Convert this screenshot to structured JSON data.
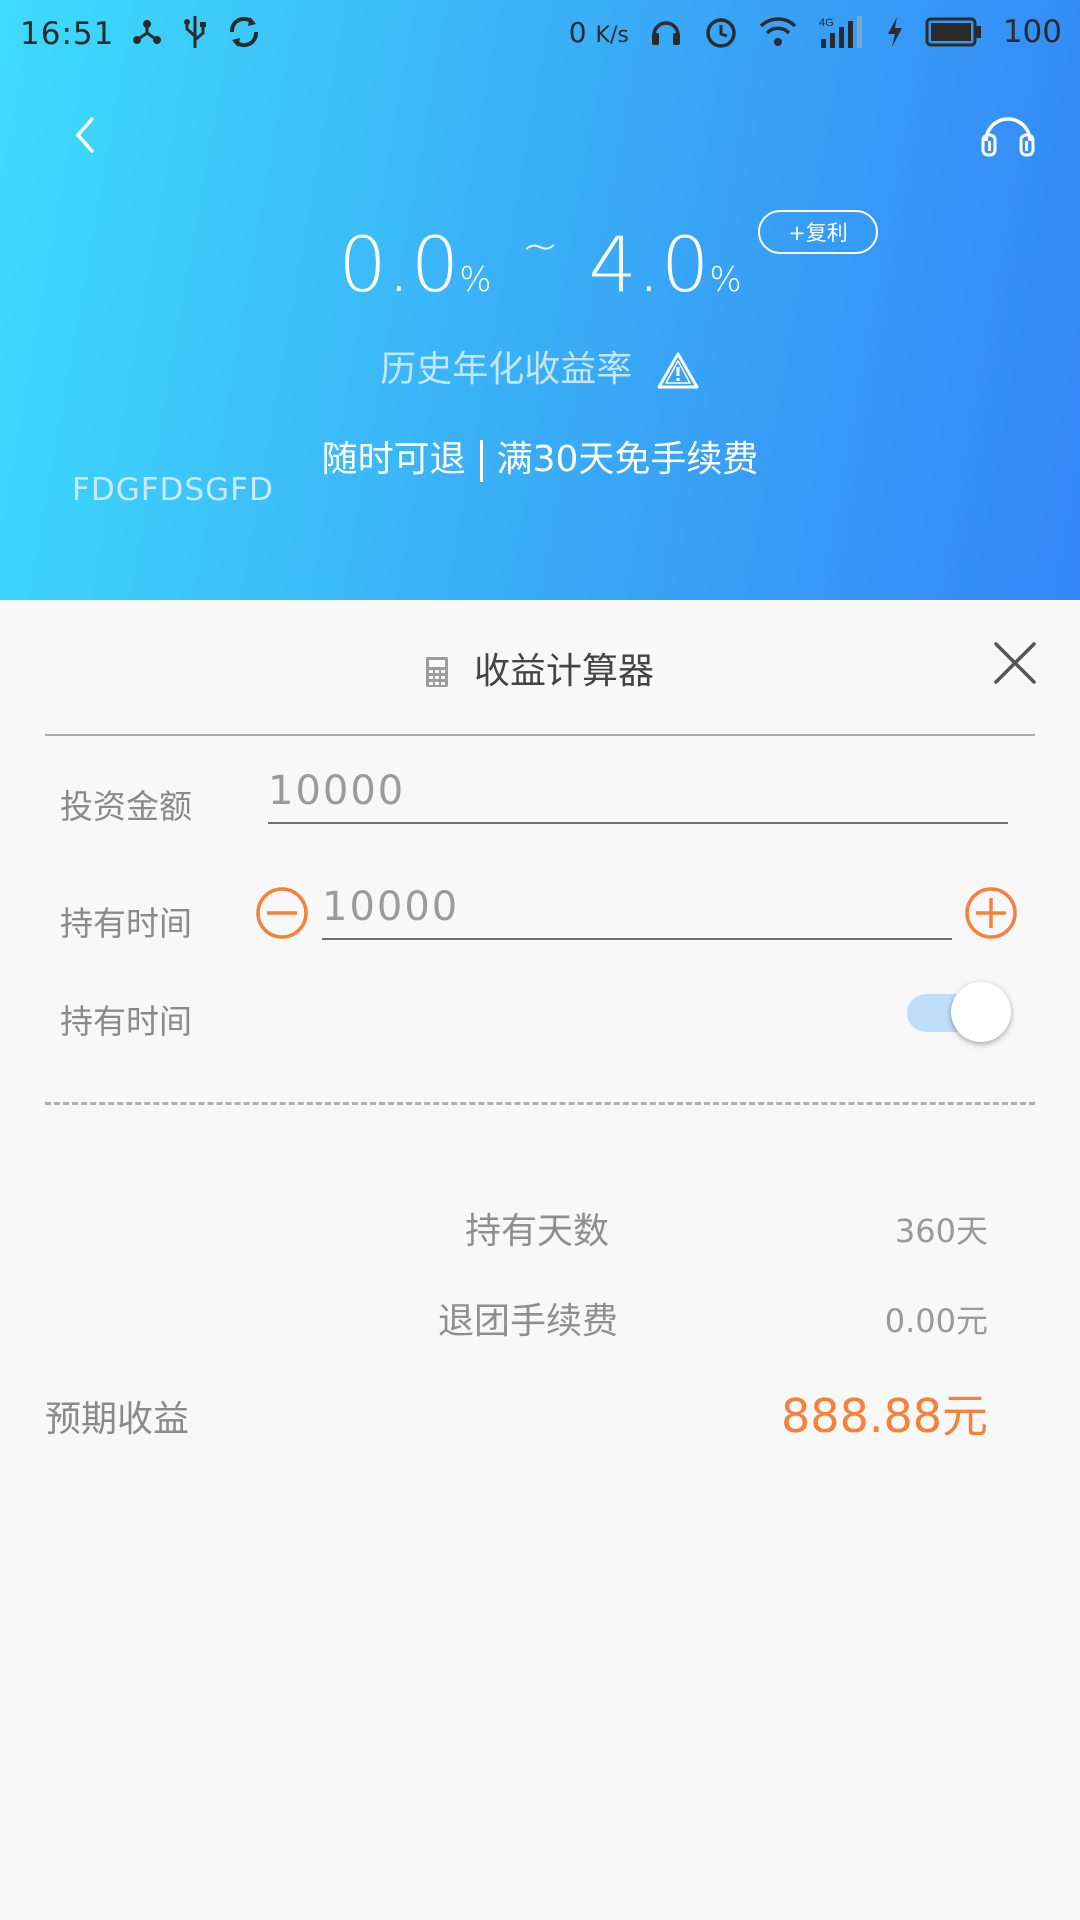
{
  "status_bar": {
    "time": "16:51",
    "net_speed_value": "0",
    "net_speed_unit": "K/s",
    "network": "4G",
    "battery": "100",
    "icons": [
      "share-hub-icon",
      "usb-icon",
      "sync-icon",
      "headset-icon",
      "alarm-icon",
      "wifi-icon",
      "signal-icon",
      "charging-icon",
      "battery-icon"
    ]
  },
  "header": {
    "rate_min": "0.0",
    "rate_max": "4.0",
    "percent": "%",
    "tilde": "~",
    "compound_badge": "+复利",
    "rate_caption": "历史年化收益率",
    "feature_left": "随时可退",
    "feature_right": "满30天免手续费",
    "fund_code": "FDGFDSGFD",
    "colors": {
      "gradient_start": "#3ddcfc",
      "gradient_end": "#3386f7"
    }
  },
  "calculator": {
    "title": "收益计算器",
    "invest_label": "投资金额",
    "invest_value": "10000",
    "hold_label": "持有时间",
    "hold_value": "10000",
    "toggle_label": "持有时间",
    "toggle_on": true,
    "days_label": "持有天数",
    "days_value": "360天",
    "fee_label": "退团手续费",
    "fee_value": "0.00元",
    "expect_label": "预期收益",
    "expect_value": "888.88元",
    "colors": {
      "accent": "#f5823b",
      "toggle_track": "#bfdef9"
    }
  }
}
